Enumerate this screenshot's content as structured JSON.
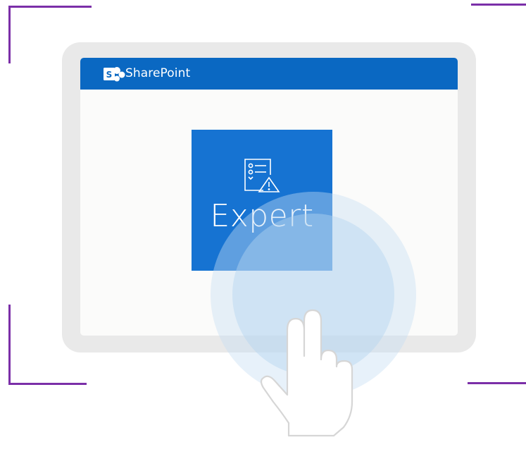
{
  "app": {
    "title": "SharePoint",
    "brand_color": "#0a68c2",
    "icon": "sharepoint-logo-icon"
  },
  "tile": {
    "label": "Expert",
    "color": "#1673d2",
    "icon": "checklist-warning-icon"
  },
  "overlay": {
    "gesture_icon": "tap-hand-icon",
    "accent_color": "#7b2fa8"
  }
}
